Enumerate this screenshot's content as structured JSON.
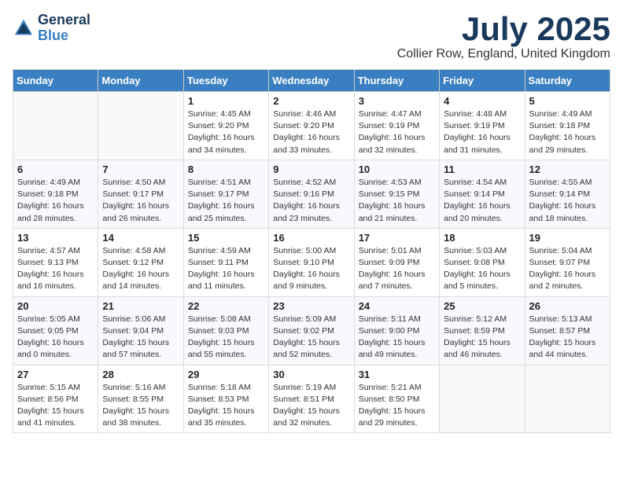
{
  "header": {
    "logo_line1": "General",
    "logo_line2": "Blue",
    "month_title": "July 2025",
    "location": "Collier Row, England, United Kingdom"
  },
  "days_of_week": [
    "Sunday",
    "Monday",
    "Tuesday",
    "Wednesday",
    "Thursday",
    "Friday",
    "Saturday"
  ],
  "weeks": [
    [
      {
        "day": "",
        "detail": ""
      },
      {
        "day": "",
        "detail": ""
      },
      {
        "day": "1",
        "detail": "Sunrise: 4:45 AM\nSunset: 9:20 PM\nDaylight: 16 hours\nand 34 minutes."
      },
      {
        "day": "2",
        "detail": "Sunrise: 4:46 AM\nSunset: 9:20 PM\nDaylight: 16 hours\nand 33 minutes."
      },
      {
        "day": "3",
        "detail": "Sunrise: 4:47 AM\nSunset: 9:19 PM\nDaylight: 16 hours\nand 32 minutes."
      },
      {
        "day": "4",
        "detail": "Sunrise: 4:48 AM\nSunset: 9:19 PM\nDaylight: 16 hours\nand 31 minutes."
      },
      {
        "day": "5",
        "detail": "Sunrise: 4:49 AM\nSunset: 9:18 PM\nDaylight: 16 hours\nand 29 minutes."
      }
    ],
    [
      {
        "day": "6",
        "detail": "Sunrise: 4:49 AM\nSunset: 9:18 PM\nDaylight: 16 hours\nand 28 minutes."
      },
      {
        "day": "7",
        "detail": "Sunrise: 4:50 AM\nSunset: 9:17 PM\nDaylight: 16 hours\nand 26 minutes."
      },
      {
        "day": "8",
        "detail": "Sunrise: 4:51 AM\nSunset: 9:17 PM\nDaylight: 16 hours\nand 25 minutes."
      },
      {
        "day": "9",
        "detail": "Sunrise: 4:52 AM\nSunset: 9:16 PM\nDaylight: 16 hours\nand 23 minutes."
      },
      {
        "day": "10",
        "detail": "Sunrise: 4:53 AM\nSunset: 9:15 PM\nDaylight: 16 hours\nand 21 minutes."
      },
      {
        "day": "11",
        "detail": "Sunrise: 4:54 AM\nSunset: 9:14 PM\nDaylight: 16 hours\nand 20 minutes."
      },
      {
        "day": "12",
        "detail": "Sunrise: 4:55 AM\nSunset: 9:14 PM\nDaylight: 16 hours\nand 18 minutes."
      }
    ],
    [
      {
        "day": "13",
        "detail": "Sunrise: 4:57 AM\nSunset: 9:13 PM\nDaylight: 16 hours\nand 16 minutes."
      },
      {
        "day": "14",
        "detail": "Sunrise: 4:58 AM\nSunset: 9:12 PM\nDaylight: 16 hours\nand 14 minutes."
      },
      {
        "day": "15",
        "detail": "Sunrise: 4:59 AM\nSunset: 9:11 PM\nDaylight: 16 hours\nand 11 minutes."
      },
      {
        "day": "16",
        "detail": "Sunrise: 5:00 AM\nSunset: 9:10 PM\nDaylight: 16 hours\nand 9 minutes."
      },
      {
        "day": "17",
        "detail": "Sunrise: 5:01 AM\nSunset: 9:09 PM\nDaylight: 16 hours\nand 7 minutes."
      },
      {
        "day": "18",
        "detail": "Sunrise: 5:03 AM\nSunset: 9:08 PM\nDaylight: 16 hours\nand 5 minutes."
      },
      {
        "day": "19",
        "detail": "Sunrise: 5:04 AM\nSunset: 9:07 PM\nDaylight: 16 hours\nand 2 minutes."
      }
    ],
    [
      {
        "day": "20",
        "detail": "Sunrise: 5:05 AM\nSunset: 9:05 PM\nDaylight: 16 hours\nand 0 minutes."
      },
      {
        "day": "21",
        "detail": "Sunrise: 5:06 AM\nSunset: 9:04 PM\nDaylight: 15 hours\nand 57 minutes."
      },
      {
        "day": "22",
        "detail": "Sunrise: 5:08 AM\nSunset: 9:03 PM\nDaylight: 15 hours\nand 55 minutes."
      },
      {
        "day": "23",
        "detail": "Sunrise: 5:09 AM\nSunset: 9:02 PM\nDaylight: 15 hours\nand 52 minutes."
      },
      {
        "day": "24",
        "detail": "Sunrise: 5:11 AM\nSunset: 9:00 PM\nDaylight: 15 hours\nand 49 minutes."
      },
      {
        "day": "25",
        "detail": "Sunrise: 5:12 AM\nSunset: 8:59 PM\nDaylight: 15 hours\nand 46 minutes."
      },
      {
        "day": "26",
        "detail": "Sunrise: 5:13 AM\nSunset: 8:57 PM\nDaylight: 15 hours\nand 44 minutes."
      }
    ],
    [
      {
        "day": "27",
        "detail": "Sunrise: 5:15 AM\nSunset: 8:56 PM\nDaylight: 15 hours\nand 41 minutes."
      },
      {
        "day": "28",
        "detail": "Sunrise: 5:16 AM\nSunset: 8:55 PM\nDaylight: 15 hours\nand 38 minutes."
      },
      {
        "day": "29",
        "detail": "Sunrise: 5:18 AM\nSunset: 8:53 PM\nDaylight: 15 hours\nand 35 minutes."
      },
      {
        "day": "30",
        "detail": "Sunrise: 5:19 AM\nSunset: 8:51 PM\nDaylight: 15 hours\nand 32 minutes."
      },
      {
        "day": "31",
        "detail": "Sunrise: 5:21 AM\nSunset: 8:50 PM\nDaylight: 15 hours\nand 29 minutes."
      },
      {
        "day": "",
        "detail": ""
      },
      {
        "day": "",
        "detail": ""
      }
    ]
  ]
}
